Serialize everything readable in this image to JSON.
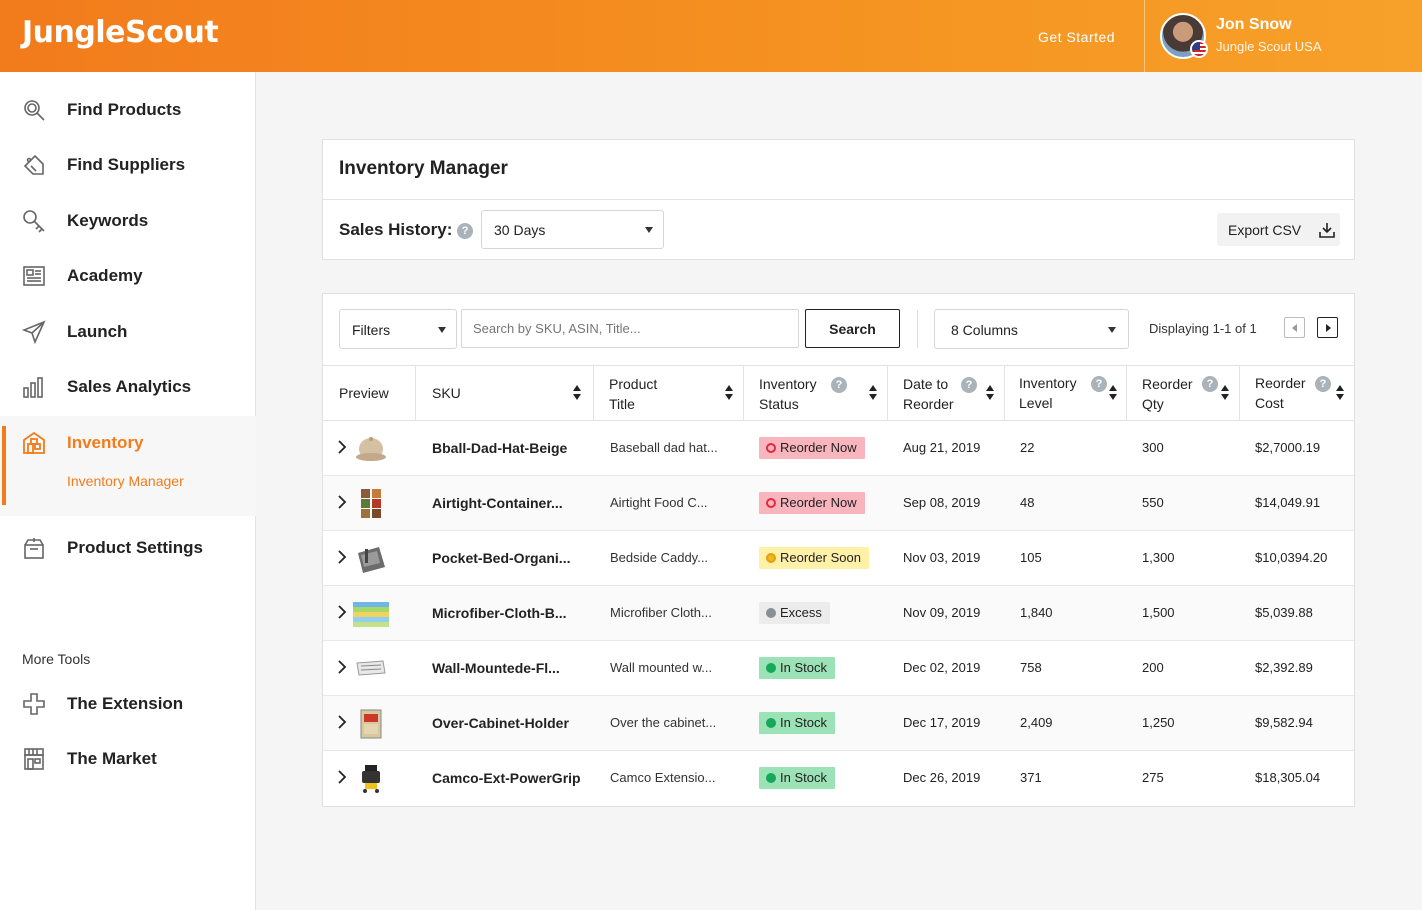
{
  "header": {
    "logo": "JungleScout",
    "get_started": "Get Started",
    "user_name": "Jon Snow",
    "user_org": "Jungle Scout USA"
  },
  "sidebar": {
    "items": [
      {
        "label": "Find Products",
        "icon": "search-icon"
      },
      {
        "label": "Find Suppliers",
        "icon": "tag-icon"
      },
      {
        "label": "Keywords",
        "icon": "key-search-icon"
      },
      {
        "label": "Academy",
        "icon": "book-icon"
      },
      {
        "label": "Launch",
        "icon": "paper-plane-icon"
      },
      {
        "label": "Sales Analytics",
        "icon": "bar-chart-icon"
      },
      {
        "label": "Inventory",
        "icon": "warehouse-icon"
      },
      {
        "label": "Product Settings",
        "icon": "box-icon"
      }
    ],
    "inventory_sub": "Inventory Manager",
    "more_tools_heading": "More Tools",
    "more_tools": [
      {
        "label": "The Extension",
        "icon": "puzzle-icon"
      },
      {
        "label": "The Market",
        "icon": "store-icon"
      }
    ]
  },
  "manager": {
    "title": "Inventory Manager",
    "sales_history_label": "Sales History:",
    "sales_history_value": "30 Days",
    "export_label": "Export CSV"
  },
  "toolbar": {
    "filters": "Filters",
    "search_placeholder": "Search by SKU, ASIN, Title...",
    "search_button": "Search",
    "columns": "8 Columns",
    "displaying": "Displaying 1-1 of 1"
  },
  "columns": {
    "preview": "Preview",
    "sku": "SKU",
    "title_l1": "Product",
    "title_l2": "Title",
    "status_l1": "Inventory",
    "status_l2": "Status",
    "date_l1": "Date to",
    "date_l2": "Reorder",
    "level_l1": "Inventory",
    "level_l2": "Level",
    "qty_l1": "Reorder",
    "qty_l2": "Qty",
    "cost_l1": "Reorder",
    "cost_l2": "Cost"
  },
  "rows": [
    {
      "sku": "Bball-Dad-Hat-Beige",
      "title": "Baseball dad hat...",
      "status": "Reorder Now",
      "date": "Aug 21, 2019",
      "level": "22",
      "qty": "300",
      "cost": "$2,7000.19"
    },
    {
      "sku": "Airtight-Container...",
      "title": "Airtight Food C...",
      "status": "Reorder Now",
      "date": "Sep 08, 2019",
      "level": "48",
      "qty": "550",
      "cost": "$14,049.91"
    },
    {
      "sku": "Pocket-Bed-Organi...",
      "title": "Bedside Caddy...",
      "status": "Reorder Soon",
      "date": "Nov 03, 2019",
      "level": "105",
      "qty": "1,300",
      "cost": "$10,0394.20"
    },
    {
      "sku": "Microfiber-Cloth-B...",
      "title": "Microfiber Cloth...",
      "status": "Excess",
      "date": "Nov 09, 2019",
      "level": "1,840",
      "qty": "1,500",
      "cost": "$5,039.88"
    },
    {
      "sku": "Wall-Mountede-Fl...",
      "title": "Wall mounted w...",
      "status": "In Stock",
      "date": "Dec 02, 2019",
      "level": "758",
      "qty": "200",
      "cost": "$2,392.89"
    },
    {
      "sku": "Over-Cabinet-Holder",
      "title": "Over the cabinet...",
      "status": "In Stock",
      "date": "Dec 17, 2019",
      "level": "2,409",
      "qty": "1,250",
      "cost": "$9,582.94"
    },
    {
      "sku": "Camco-Ext-PowerGrip",
      "title": "Camco Extensio...",
      "status": "In Stock",
      "date": "Dec 26, 2019",
      "level": "371",
      "qty": "275",
      "cost": "$18,305.04"
    }
  ],
  "colors": {
    "brand_orange": "#f27b1c",
    "reorder_now": "#f8b5bd",
    "reorder_soon": "#fff1a8",
    "excess": "#ececec",
    "in_stock": "#9be2b6"
  }
}
